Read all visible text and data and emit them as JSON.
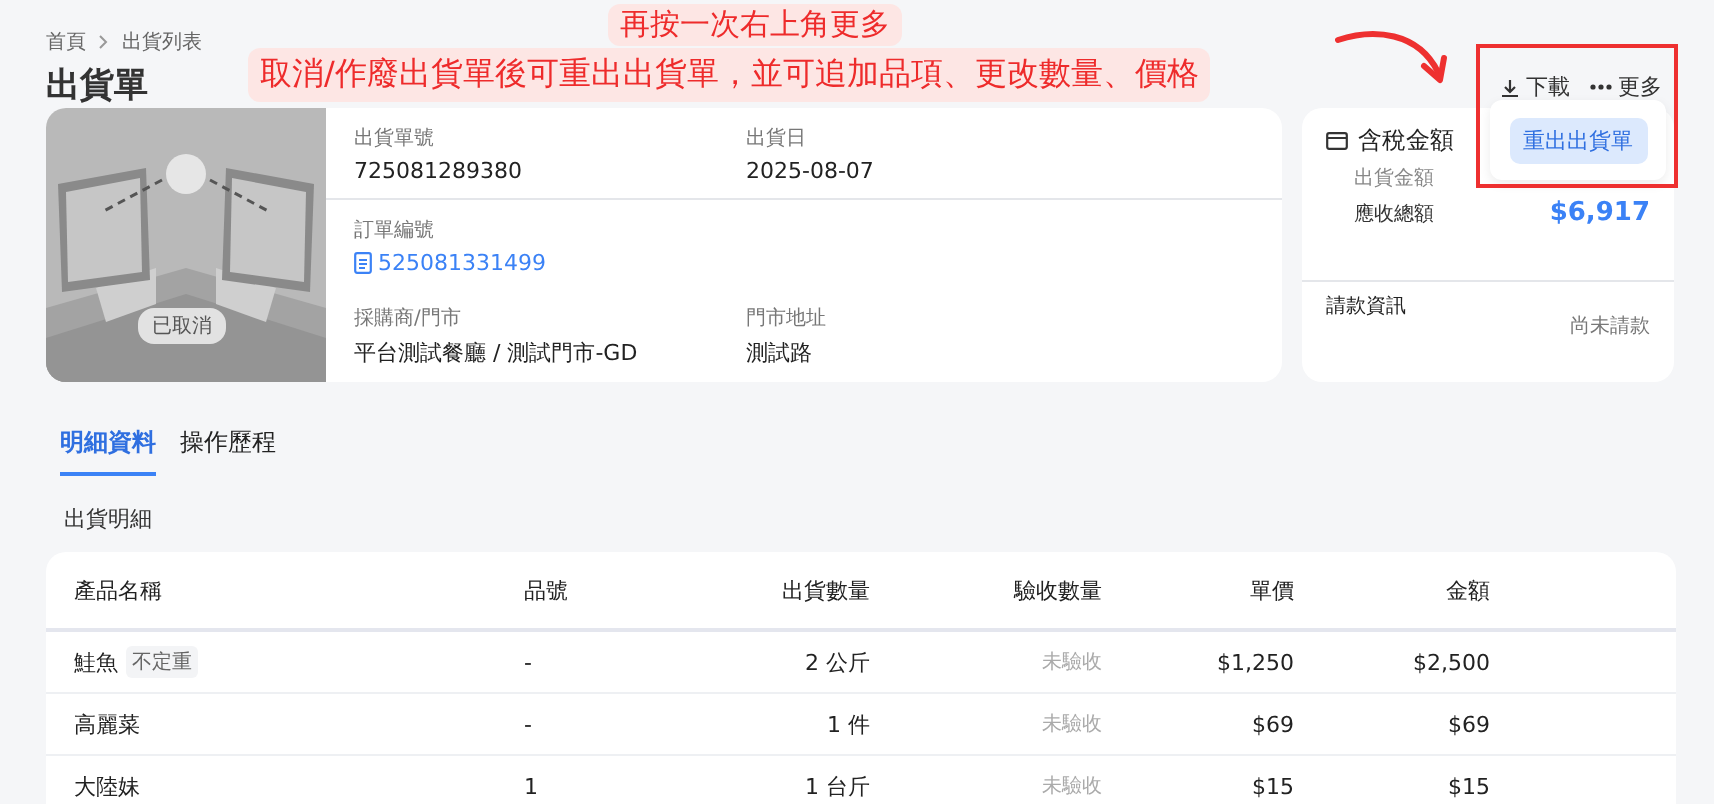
{
  "breadcrumb": [
    "首頁",
    "出貨列表"
  ],
  "title": "出貨單",
  "annotations": [
    "再按一次右上角更多",
    "取消/作廢出貨單後可重出出貨單，並可追加品項、更改數量、價格"
  ],
  "actions": [
    {
      "label": "下載",
      "kind": "download"
    },
    {
      "label": "更多",
      "kind": "more"
    }
  ],
  "dropdown": {
    "items": [
      "重出出貨單"
    ]
  },
  "status_badge": "已取消",
  "info": [
    [
      {
        "label": "出貨單號",
        "value": "725081289380",
        "kind": "text"
      },
      {
        "label": "出貨日",
        "value": "2025-08-07",
        "kind": "text"
      }
    ],
    [
      {
        "label": "訂單編號",
        "value": "525081331499",
        "kind": "link"
      }
    ],
    [
      {
        "label": "採購商/門市",
        "value": "平台測試餐廳 / 測試門市-GD",
        "kind": "text"
      },
      {
        "label": "門市地址",
        "value": "測試路",
        "kind": "text"
      }
    ]
  ],
  "summary": {
    "title": "含稅金額",
    "rows": [
      {
        "label": "出貨金額"
      },
      {
        "label": "應收總額",
        "value": "$6,917"
      }
    ],
    "billing": {
      "label": "請款資訊",
      "value": "尚未請款"
    }
  },
  "tabs": [
    {
      "label": "明細資料",
      "selected": true
    },
    {
      "label": "操作歷程",
      "selected": false
    }
  ],
  "section_title": "出貨明細",
  "table": {
    "columns": [
      "產品名稱",
      "品號",
      "出貨數量",
      "驗收數量",
      "單價",
      "金額"
    ],
    "rows": [
      {
        "cells": [
          "鮭魚",
          "-",
          "2 公斤",
          "未驗收",
          "$1,250",
          "$2,500"
        ],
        "tag": "不定重"
      },
      {
        "cells": [
          "高麗菜",
          "-",
          "1 件",
          "未驗收",
          "$69",
          "$69"
        ]
      },
      {
        "cells": [
          "大陸妹",
          "1",
          "1 台斤",
          "未驗收",
          "$15",
          "$15"
        ]
      }
    ]
  }
}
